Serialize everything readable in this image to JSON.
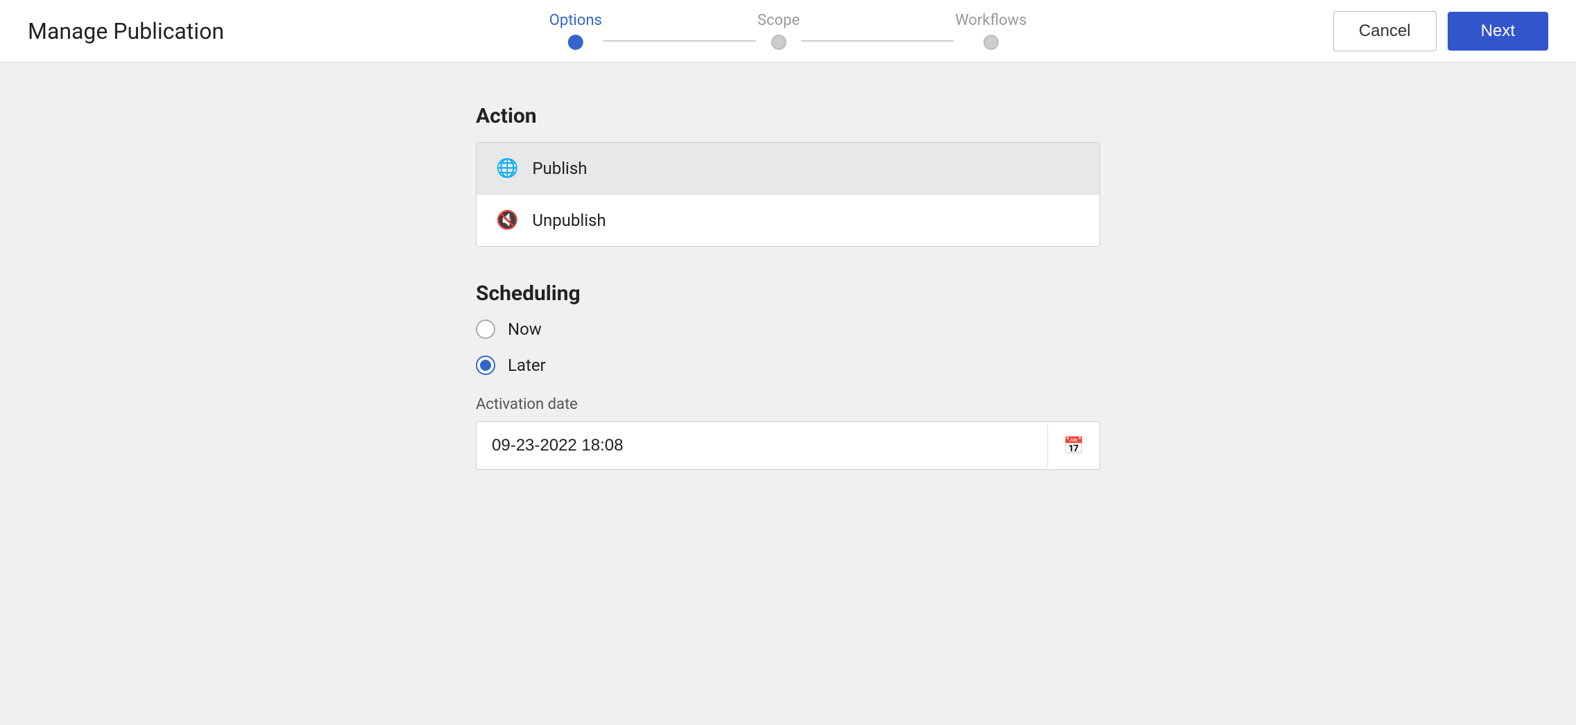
{
  "header": {
    "title": "Manage Publication",
    "cancel_label": "Cancel",
    "next_label": "Next"
  },
  "stepper": {
    "steps": [
      {
        "label": "Options",
        "state": "active"
      },
      {
        "label": "Scope",
        "state": "inactive"
      },
      {
        "label": "Workflows",
        "state": "inactive"
      }
    ]
  },
  "action_section": {
    "title": "Action",
    "items": [
      {
        "label": "Publish",
        "icon": "🌐",
        "selected": true
      },
      {
        "label": "Unpublish",
        "icon": "🔇",
        "selected": false
      }
    ]
  },
  "scheduling_section": {
    "title": "Scheduling",
    "options": [
      {
        "label": "Now",
        "checked": false
      },
      {
        "label": "Later",
        "checked": true
      }
    ],
    "activation_date_label": "Activation date",
    "activation_date_value": "09-23-2022 18:08",
    "calendar_icon": "📅"
  }
}
